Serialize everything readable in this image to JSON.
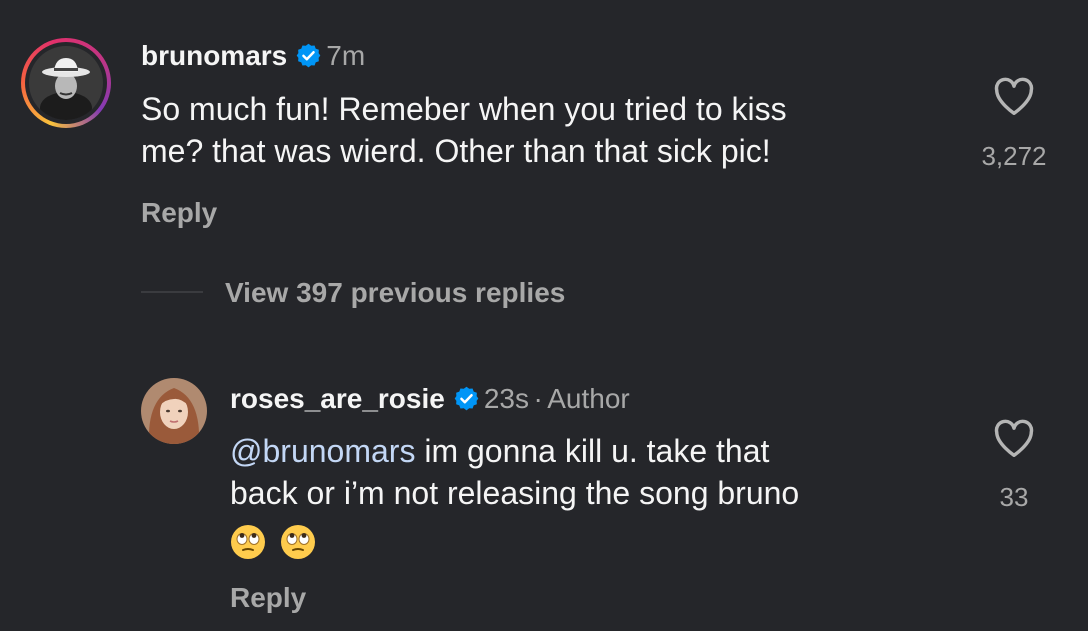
{
  "comment": {
    "username": "brunomars",
    "time": "7m",
    "text_line1": "So much fun! Remeber when you tried to kiss",
    "text_line2": "me? that was wierd. Other than that sick pic!",
    "reply_label": "Reply",
    "like_count": "3,272"
  },
  "view_replies_label": "View 397 previous replies",
  "reply": {
    "username": "roses_are_rosie",
    "time": "23s",
    "separator": "·",
    "author_label": "Author",
    "mention": "@brunomars",
    "text_line1": " im gonna kill u. take that",
    "text_line2": "back or i’m not releasing the song bruno",
    "emojis": [
      "face-with-rolling-eyes",
      "face-with-rolling-eyes"
    ],
    "reply_label": "Reply",
    "like_count": "33"
  },
  "colors": {
    "background": "#25262a",
    "verified": "#0095f6",
    "mention": "#c3d7f5",
    "secondary_text": "#a8a8a8"
  }
}
